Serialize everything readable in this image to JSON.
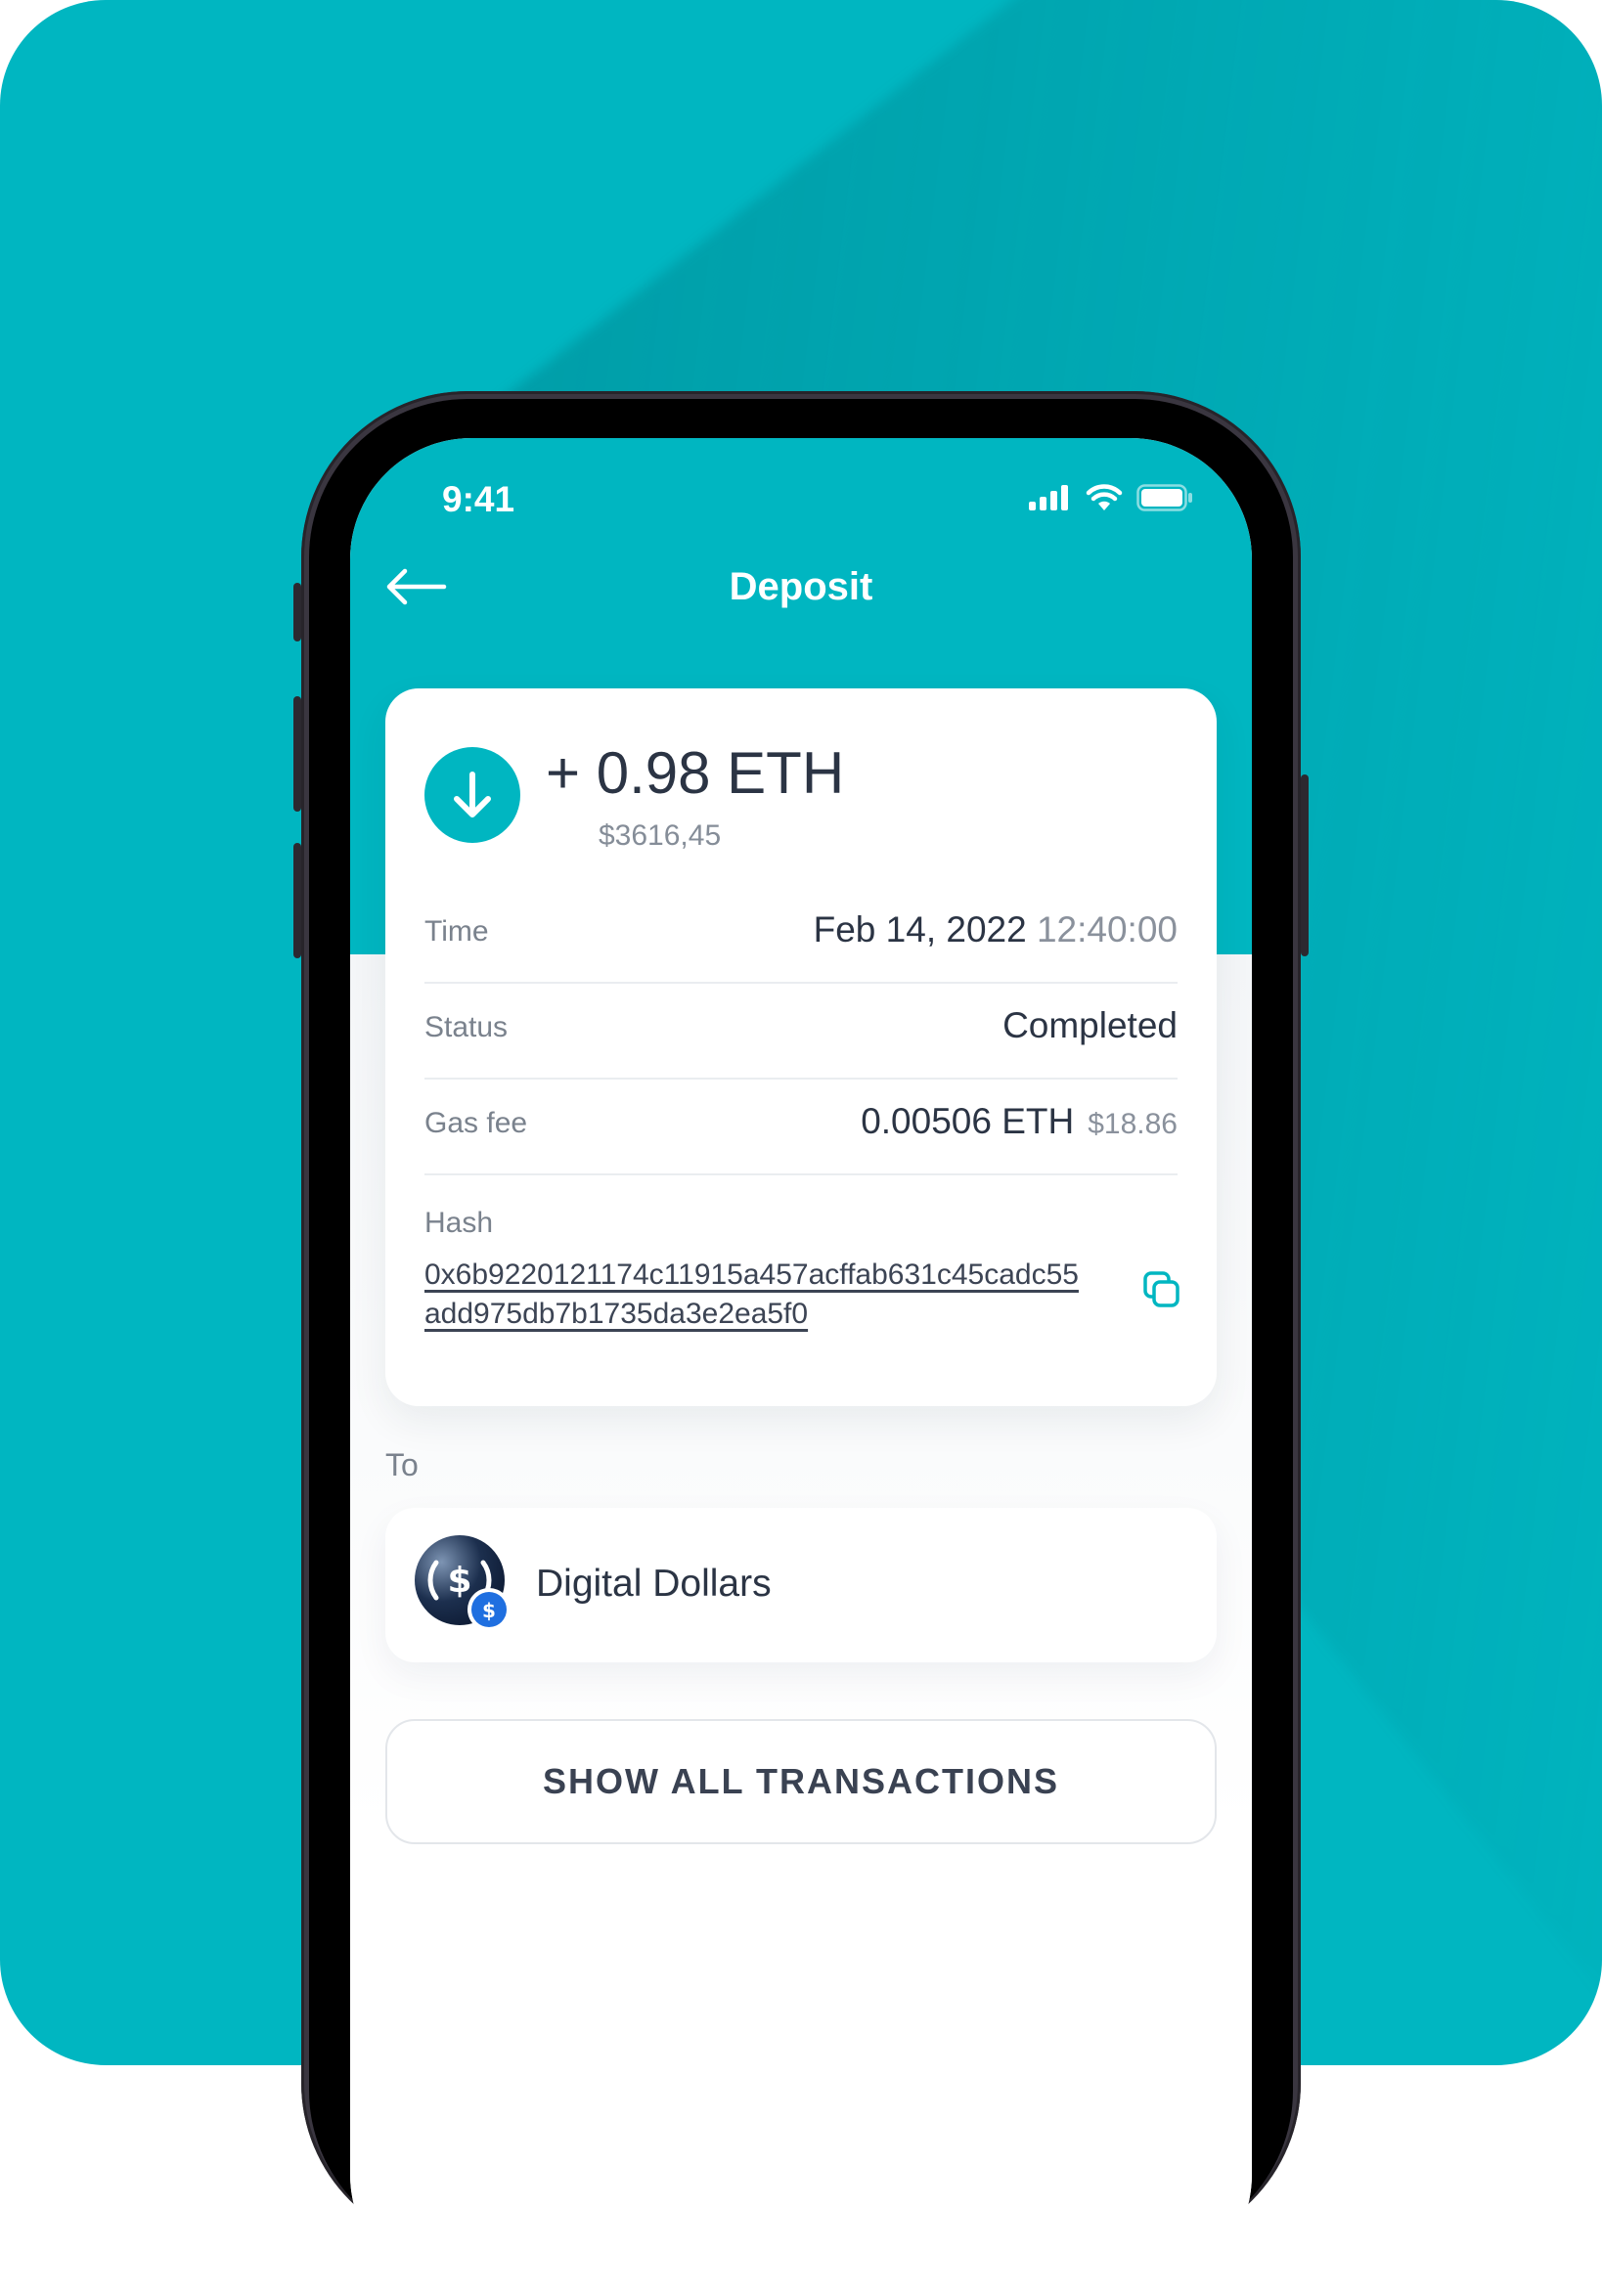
{
  "status_bar": {
    "time": "9:41"
  },
  "header": {
    "title": "Deposit",
    "back_icon": "arrow-left-icon"
  },
  "transaction": {
    "icon": "arrow-down-icon",
    "amount": "+ 0.98 ETH",
    "fiat": "$3616,45",
    "details": {
      "time_label": "Time",
      "time_date": "Feb 14, 2022",
      "time_clock": "12:40:00",
      "status_label": "Status",
      "status_value": "Completed",
      "gas_label": "Gas fee",
      "gas_value": "0.00506 ETH",
      "gas_fiat": "$18.86",
      "hash_label": "Hash",
      "hash_line1": "0x6b9220121174c11915a457acffab631c45cadc55",
      "hash_line2": "add975db7b1735da3e2ea5f0"
    }
  },
  "recipient": {
    "section_label": "To",
    "name": "Digital Dollars",
    "avatar_icon": "digital-dollars-logo-icon"
  },
  "actions": {
    "show_all": "SHOW ALL TRANSACTIONS"
  },
  "colors": {
    "accent": "#00b6c1",
    "text": "#2b3444",
    "muted": "#858d98"
  }
}
